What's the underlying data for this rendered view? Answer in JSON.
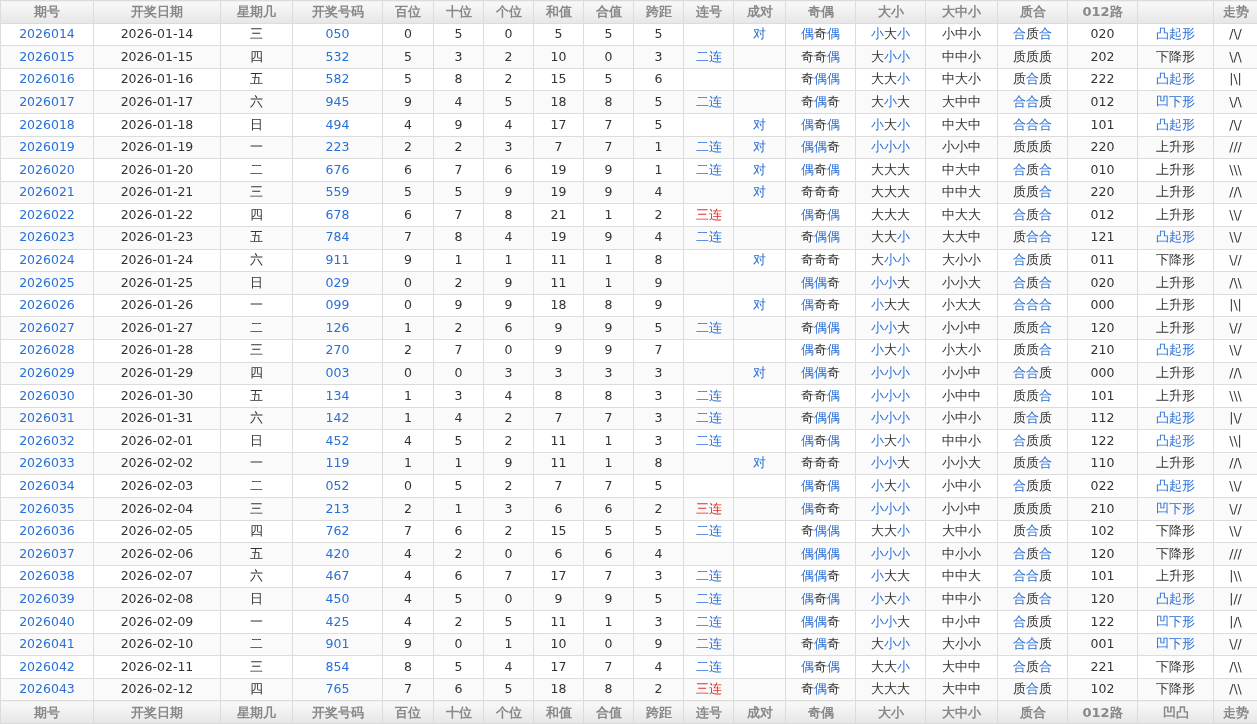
{
  "header": [
    {
      "label": "期号"
    },
    {
      "label": "开奖日期"
    },
    {
      "label": "星期几"
    },
    {
      "label": "开奖号码"
    },
    {
      "label": "百位"
    },
    {
      "label": "十位"
    },
    {
      "label": "个位"
    },
    {
      "label": "和值"
    },
    {
      "label": "合值"
    },
    {
      "label": "跨距"
    },
    {
      "label": "连号"
    },
    {
      "label": "成对"
    },
    {
      "label": "奇偶"
    },
    {
      "label": "大小"
    },
    {
      "label": "大中小"
    },
    {
      "label": "质合"
    },
    {
      "label": "012路"
    },
    {
      "label": "走势"
    }
  ],
  "rows": [
    {
      "c": [
        "2026014",
        "2026-01-14",
        "三",
        "050",
        "0",
        "5",
        "0",
        "5",
        "5",
        "5"
      ],
      "pair": "对",
      "parity": {
        "text": "偶奇偶",
        "hl": [
          true,
          false,
          true
        ]
      },
      "size": {
        "text": "小大小",
        "hl": [
          true,
          false,
          true
        ]
      },
      "range": "小中小",
      "prime": {
        "text": "合质合",
        "hl": [
          true,
          false,
          true
        ]
      },
      "route": "020",
      "shape": {
        "text": "凸起形",
        "hl": true
      },
      "trend": "/\\/"
    },
    {
      "c": [
        "2026015",
        "2026-01-15",
        "四",
        "532",
        "5",
        "3",
        "2",
        "10",
        "0",
        "3"
      ],
      "consec": {
        "text": "二连",
        "kind": "two"
      },
      "parity": {
        "text": "奇奇偶",
        "hl": [
          false,
          false,
          true
        ]
      },
      "size": {
        "text": "大小小",
        "hl": [
          false,
          true,
          true
        ]
      },
      "range": "中中小",
      "prime": {
        "text": "质质质",
        "hl": [
          false,
          false,
          false
        ]
      },
      "route": "202",
      "shape": {
        "text": "下降形",
        "hl": false
      },
      "trend": "\\/\\"
    },
    {
      "c": [
        "2026016",
        "2026-01-16",
        "五",
        "582",
        "5",
        "8",
        "2",
        "15",
        "5",
        "6"
      ],
      "parity": {
        "text": "奇偶偶",
        "hl": [
          false,
          true,
          true
        ]
      },
      "size": {
        "text": "大大小",
        "hl": [
          false,
          false,
          true
        ]
      },
      "range": "中大小",
      "prime": {
        "text": "质合质",
        "hl": [
          false,
          true,
          false
        ]
      },
      "route": "222",
      "shape": {
        "text": "凸起形",
        "hl": true
      },
      "trend": "|\\|"
    },
    {
      "c": [
        "2026017",
        "2026-01-17",
        "六",
        "945",
        "9",
        "4",
        "5",
        "18",
        "8",
        "5"
      ],
      "consec": {
        "text": "二连",
        "kind": "two"
      },
      "parity": {
        "text": "奇偶奇",
        "hl": [
          false,
          true,
          false
        ]
      },
      "size": {
        "text": "大小大",
        "hl": [
          false,
          true,
          false
        ]
      },
      "range": "大中中",
      "prime": {
        "text": "合合质",
        "hl": [
          true,
          true,
          false
        ]
      },
      "route": "012",
      "shape": {
        "text": "凹下形",
        "hl": true
      },
      "trend": "\\/\\"
    },
    {
      "c": [
        "2026018",
        "2026-01-18",
        "日",
        "494",
        "4",
        "9",
        "4",
        "17",
        "7",
        "5"
      ],
      "pair": "对",
      "parity": {
        "text": "偶奇偶",
        "hl": [
          true,
          false,
          true
        ]
      },
      "size": {
        "text": "小大小",
        "hl": [
          true,
          false,
          true
        ]
      },
      "range": "中大中",
      "prime": {
        "text": "合合合",
        "hl": [
          true,
          true,
          true
        ]
      },
      "route": "101",
      "shape": {
        "text": "凸起形",
        "hl": true
      },
      "trend": "/\\/"
    },
    {
      "c": [
        "2026019",
        "2026-01-19",
        "一",
        "223",
        "2",
        "2",
        "3",
        "7",
        "7",
        "1"
      ],
      "consec": {
        "text": "二连",
        "kind": "two"
      },
      "pair": "对",
      "parity": {
        "text": "偶偶奇",
        "hl": [
          true,
          true,
          false
        ]
      },
      "size": {
        "text": "小小小",
        "hl": [
          true,
          true,
          true
        ]
      },
      "range": "小小中",
      "prime": {
        "text": "质质质",
        "hl": [
          false,
          false,
          false
        ]
      },
      "route": "220",
      "shape": {
        "text": "上升形",
        "hl": false
      },
      "trend": "///"
    },
    {
      "c": [
        "2026020",
        "2026-01-20",
        "二",
        "676",
        "6",
        "7",
        "6",
        "19",
        "9",
        "1"
      ],
      "consec": {
        "text": "二连",
        "kind": "two"
      },
      "pair": "对",
      "parity": {
        "text": "偶奇偶",
        "hl": [
          true,
          false,
          true
        ]
      },
      "size": {
        "text": "大大大",
        "hl": [
          false,
          false,
          false
        ]
      },
      "range": "中大中",
      "prime": {
        "text": "合质合",
        "hl": [
          true,
          false,
          true
        ]
      },
      "route": "010",
      "shape": {
        "text": "上升形",
        "hl": false
      },
      "trend": "\\\\\\"
    },
    {
      "c": [
        "2026021",
        "2026-01-21",
        "三",
        "559",
        "5",
        "5",
        "9",
        "19",
        "9",
        "4"
      ],
      "pair": "对",
      "parity": {
        "text": "奇奇奇",
        "hl": [
          false,
          false,
          false
        ]
      },
      "size": {
        "text": "大大大",
        "hl": [
          false,
          false,
          false
        ]
      },
      "range": "中中大",
      "prime": {
        "text": "质质合",
        "hl": [
          false,
          false,
          true
        ]
      },
      "route": "220",
      "shape": {
        "text": "上升形",
        "hl": false
      },
      "trend": "//\\"
    },
    {
      "c": [
        "2026022",
        "2026-01-22",
        "四",
        "678",
        "6",
        "7",
        "8",
        "21",
        "1",
        "2"
      ],
      "consec": {
        "text": "三连",
        "kind": "three"
      },
      "parity": {
        "text": "偶奇偶",
        "hl": [
          true,
          false,
          true
        ]
      },
      "size": {
        "text": "大大大",
        "hl": [
          false,
          false,
          false
        ]
      },
      "range": "中大大",
      "prime": {
        "text": "合质合",
        "hl": [
          true,
          false,
          true
        ]
      },
      "route": "012",
      "shape": {
        "text": "上升形",
        "hl": false
      },
      "trend": "\\\\/"
    },
    {
      "c": [
        "2026023",
        "2026-01-23",
        "五",
        "784",
        "7",
        "8",
        "4",
        "19",
        "9",
        "4"
      ],
      "consec": {
        "text": "二连",
        "kind": "two"
      },
      "parity": {
        "text": "奇偶偶",
        "hl": [
          false,
          true,
          true
        ]
      },
      "size": {
        "text": "大大小",
        "hl": [
          false,
          false,
          true
        ]
      },
      "range": "大大中",
      "prime": {
        "text": "质合合",
        "hl": [
          false,
          true,
          true
        ]
      },
      "route": "121",
      "shape": {
        "text": "凸起形",
        "hl": true
      },
      "trend": "\\\\/"
    },
    {
      "c": [
        "2026024",
        "2026-01-24",
        "六",
        "911",
        "9",
        "1",
        "1",
        "11",
        "1",
        "8"
      ],
      "pair": "对",
      "parity": {
        "text": "奇奇奇",
        "hl": [
          false,
          false,
          false
        ]
      },
      "size": {
        "text": "大小小",
        "hl": [
          false,
          true,
          true
        ]
      },
      "range": "大小小",
      "prime": {
        "text": "合质质",
        "hl": [
          true,
          false,
          false
        ]
      },
      "route": "011",
      "shape": {
        "text": "下降形",
        "hl": false
      },
      "trend": "\\//"
    },
    {
      "c": [
        "2026025",
        "2026-01-25",
        "日",
        "029",
        "0",
        "2",
        "9",
        "11",
        "1",
        "9"
      ],
      "parity": {
        "text": "偶偶奇",
        "hl": [
          true,
          true,
          false
        ]
      },
      "size": {
        "text": "小小大",
        "hl": [
          true,
          true,
          false
        ]
      },
      "range": "小小大",
      "prime": {
        "text": "合质合",
        "hl": [
          true,
          false,
          true
        ]
      },
      "route": "020",
      "shape": {
        "text": "上升形",
        "hl": false
      },
      "trend": "/\\\\"
    },
    {
      "c": [
        "2026026",
        "2026-01-26",
        "一",
        "099",
        "0",
        "9",
        "9",
        "18",
        "8",
        "9"
      ],
      "pair": "对",
      "parity": {
        "text": "偶奇奇",
        "hl": [
          true,
          false,
          false
        ]
      },
      "size": {
        "text": "小大大",
        "hl": [
          true,
          false,
          false
        ]
      },
      "range": "小大大",
      "prime": {
        "text": "合合合",
        "hl": [
          true,
          true,
          true
        ]
      },
      "route": "000",
      "shape": {
        "text": "上升形",
        "hl": false
      },
      "trend": "|\\|"
    },
    {
      "c": [
        "2026027",
        "2026-01-27",
        "二",
        "126",
        "1",
        "2",
        "6",
        "9",
        "9",
        "5"
      ],
      "consec": {
        "text": "二连",
        "kind": "two"
      },
      "parity": {
        "text": "奇偶偶",
        "hl": [
          false,
          true,
          true
        ]
      },
      "size": {
        "text": "小小大",
        "hl": [
          true,
          true,
          false
        ]
      },
      "range": "小小中",
      "prime": {
        "text": "质质合",
        "hl": [
          false,
          false,
          true
        ]
      },
      "route": "120",
      "shape": {
        "text": "上升形",
        "hl": false
      },
      "trend": "\\//"
    },
    {
      "c": [
        "2026028",
        "2026-01-28",
        "三",
        "270",
        "2",
        "7",
        "0",
        "9",
        "9",
        "7"
      ],
      "parity": {
        "text": "偶奇偶",
        "hl": [
          true,
          false,
          true
        ]
      },
      "size": {
        "text": "小大小",
        "hl": [
          true,
          false,
          true
        ]
      },
      "range": "小大小",
      "prime": {
        "text": "质质合",
        "hl": [
          false,
          false,
          true
        ]
      },
      "route": "210",
      "shape": {
        "text": "凸起形",
        "hl": true
      },
      "trend": "\\\\/"
    },
    {
      "c": [
        "2026029",
        "2026-01-29",
        "四",
        "003",
        "0",
        "0",
        "3",
        "3",
        "3",
        "3"
      ],
      "pair": "对",
      "parity": {
        "text": "偶偶奇",
        "hl": [
          true,
          true,
          false
        ]
      },
      "size": {
        "text": "小小小",
        "hl": [
          true,
          true,
          true
        ]
      },
      "range": "小小中",
      "prime": {
        "text": "合合质",
        "hl": [
          true,
          true,
          false
        ]
      },
      "route": "000",
      "shape": {
        "text": "上升形",
        "hl": false
      },
      "trend": "//\\"
    },
    {
      "c": [
        "2026030",
        "2026-01-30",
        "五",
        "134",
        "1",
        "3",
        "4",
        "8",
        "8",
        "3"
      ],
      "consec": {
        "text": "二连",
        "kind": "two"
      },
      "parity": {
        "text": "奇奇偶",
        "hl": [
          false,
          false,
          true
        ]
      },
      "size": {
        "text": "小小小",
        "hl": [
          true,
          true,
          true
        ]
      },
      "range": "小中中",
      "prime": {
        "text": "质质合",
        "hl": [
          false,
          false,
          true
        ]
      },
      "route": "101",
      "shape": {
        "text": "上升形",
        "hl": false
      },
      "trend": "\\\\\\"
    },
    {
      "c": [
        "2026031",
        "2026-01-31",
        "六",
        "142",
        "1",
        "4",
        "2",
        "7",
        "7",
        "3"
      ],
      "consec": {
        "text": "二连",
        "kind": "two"
      },
      "parity": {
        "text": "奇偶偶",
        "hl": [
          false,
          true,
          true
        ]
      },
      "size": {
        "text": "小小小",
        "hl": [
          true,
          true,
          true
        ]
      },
      "range": "小中小",
      "prime": {
        "text": "质合质",
        "hl": [
          false,
          true,
          false
        ]
      },
      "route": "112",
      "shape": {
        "text": "凸起形",
        "hl": true
      },
      "trend": "|\\/"
    },
    {
      "c": [
        "2026032",
        "2026-02-01",
        "日",
        "452",
        "4",
        "5",
        "2",
        "11",
        "1",
        "3"
      ],
      "consec": {
        "text": "二连",
        "kind": "two"
      },
      "parity": {
        "text": "偶奇偶",
        "hl": [
          true,
          false,
          true
        ]
      },
      "size": {
        "text": "小大小",
        "hl": [
          true,
          false,
          true
        ]
      },
      "range": "中中小",
      "prime": {
        "text": "合质质",
        "hl": [
          true,
          false,
          false
        ]
      },
      "route": "122",
      "shape": {
        "text": "凸起形",
        "hl": true
      },
      "trend": "\\\\|"
    },
    {
      "c": [
        "2026033",
        "2026-02-02",
        "一",
        "119",
        "1",
        "1",
        "9",
        "11",
        "1",
        "8"
      ],
      "pair": "对",
      "parity": {
        "text": "奇奇奇",
        "hl": [
          false,
          false,
          false
        ]
      },
      "size": {
        "text": "小小大",
        "hl": [
          true,
          true,
          false
        ]
      },
      "range": "小小大",
      "prime": {
        "text": "质质合",
        "hl": [
          false,
          false,
          true
        ]
      },
      "route": "110",
      "shape": {
        "text": "上升形",
        "hl": false
      },
      "trend": "//\\"
    },
    {
      "c": [
        "2026034",
        "2026-02-03",
        "二",
        "052",
        "0",
        "5",
        "2",
        "7",
        "7",
        "5"
      ],
      "parity": {
        "text": "偶奇偶",
        "hl": [
          true,
          false,
          true
        ]
      },
      "size": {
        "text": "小大小",
        "hl": [
          true,
          false,
          true
        ]
      },
      "range": "小中小",
      "prime": {
        "text": "合质质",
        "hl": [
          true,
          false,
          false
        ]
      },
      "route": "022",
      "shape": {
        "text": "凸起形",
        "hl": true
      },
      "trend": "\\\\/"
    },
    {
      "c": [
        "2026035",
        "2026-02-04",
        "三",
        "213",
        "2",
        "1",
        "3",
        "6",
        "6",
        "2"
      ],
      "consec": {
        "text": "三连",
        "kind": "three"
      },
      "parity": {
        "text": "偶奇奇",
        "hl": [
          true,
          false,
          false
        ]
      },
      "size": {
        "text": "小小小",
        "hl": [
          true,
          true,
          true
        ]
      },
      "range": "小小中",
      "prime": {
        "text": "质质质",
        "hl": [
          false,
          false,
          false
        ]
      },
      "route": "210",
      "shape": {
        "text": "凹下形",
        "hl": true
      },
      "trend": "\\//"
    },
    {
      "c": [
        "2026036",
        "2026-02-05",
        "四",
        "762",
        "7",
        "6",
        "2",
        "15",
        "5",
        "5"
      ],
      "consec": {
        "text": "二连",
        "kind": "two"
      },
      "parity": {
        "text": "奇偶偶",
        "hl": [
          false,
          true,
          true
        ]
      },
      "size": {
        "text": "大大小",
        "hl": [
          false,
          false,
          true
        ]
      },
      "range": "大中小",
      "prime": {
        "text": "质合质",
        "hl": [
          false,
          true,
          false
        ]
      },
      "route": "102",
      "shape": {
        "text": "下降形",
        "hl": false
      },
      "trend": "\\\\/"
    },
    {
      "c": [
        "2026037",
        "2026-02-06",
        "五",
        "420",
        "4",
        "2",
        "0",
        "6",
        "6",
        "4"
      ],
      "parity": {
        "text": "偶偶偶",
        "hl": [
          true,
          true,
          true
        ]
      },
      "size": {
        "text": "小小小",
        "hl": [
          true,
          true,
          true
        ]
      },
      "range": "中小小",
      "prime": {
        "text": "合质合",
        "hl": [
          true,
          false,
          true
        ]
      },
      "route": "120",
      "shape": {
        "text": "下降形",
        "hl": false
      },
      "trend": "///"
    },
    {
      "c": [
        "2026038",
        "2026-02-07",
        "六",
        "467",
        "4",
        "6",
        "7",
        "17",
        "7",
        "3"
      ],
      "consec": {
        "text": "二连",
        "kind": "two"
      },
      "parity": {
        "text": "偶偶奇",
        "hl": [
          true,
          true,
          false
        ]
      },
      "size": {
        "text": "小大大",
        "hl": [
          true,
          false,
          false
        ]
      },
      "range": "中中大",
      "prime": {
        "text": "合合质",
        "hl": [
          true,
          true,
          false
        ]
      },
      "route": "101",
      "shape": {
        "text": "上升形",
        "hl": false
      },
      "trend": "|\\\\"
    },
    {
      "c": [
        "2026039",
        "2026-02-08",
        "日",
        "450",
        "4",
        "5",
        "0",
        "9",
        "9",
        "5"
      ],
      "consec": {
        "text": "二连",
        "kind": "two"
      },
      "parity": {
        "text": "偶奇偶",
        "hl": [
          true,
          false,
          true
        ]
      },
      "size": {
        "text": "小大小",
        "hl": [
          true,
          false,
          true
        ]
      },
      "range": "中中小",
      "prime": {
        "text": "合质合",
        "hl": [
          true,
          false,
          true
        ]
      },
      "route": "120",
      "shape": {
        "text": "凸起形",
        "hl": true
      },
      "trend": "|//"
    },
    {
      "c": [
        "2026040",
        "2026-02-09",
        "一",
        "425",
        "4",
        "2",
        "5",
        "11",
        "1",
        "3"
      ],
      "consec": {
        "text": "二连",
        "kind": "two"
      },
      "parity": {
        "text": "偶偶奇",
        "hl": [
          true,
          true,
          false
        ]
      },
      "size": {
        "text": "小小大",
        "hl": [
          true,
          true,
          false
        ]
      },
      "range": "中小中",
      "prime": {
        "text": "合质质",
        "hl": [
          true,
          false,
          false
        ]
      },
      "route": "122",
      "shape": {
        "text": "凹下形",
        "hl": true
      },
      "trend": "|/\\"
    },
    {
      "c": [
        "2026041",
        "2026-02-10",
        "二",
        "901",
        "9",
        "0",
        "1",
        "10",
        "0",
        "9"
      ],
      "consec": {
        "text": "二连",
        "kind": "two"
      },
      "parity": {
        "text": "奇偶奇",
        "hl": [
          false,
          true,
          false
        ]
      },
      "size": {
        "text": "大小小",
        "hl": [
          false,
          true,
          true
        ]
      },
      "range": "大小小",
      "prime": {
        "text": "合合质",
        "hl": [
          true,
          true,
          false
        ]
      },
      "route": "001",
      "shape": {
        "text": "凹下形",
        "hl": true
      },
      "trend": "\\//"
    },
    {
      "c": [
        "2026042",
        "2026-02-11",
        "三",
        "854",
        "8",
        "5",
        "4",
        "17",
        "7",
        "4"
      ],
      "consec": {
        "text": "二连",
        "kind": "two"
      },
      "parity": {
        "text": "偶奇偶",
        "hl": [
          true,
          false,
          true
        ]
      },
      "size": {
        "text": "大大小",
        "hl": [
          false,
          false,
          true
        ]
      },
      "range": "大中中",
      "prime": {
        "text": "合质合",
        "hl": [
          true,
          false,
          true
        ]
      },
      "route": "221",
      "shape": {
        "text": "下降形",
        "hl": false
      },
      "trend": "/\\\\"
    },
    {
      "c": [
        "2026043",
        "2026-02-12",
        "四",
        "765",
        "7",
        "6",
        "5",
        "18",
        "8",
        "2"
      ],
      "consec": {
        "text": "三连",
        "kind": "three"
      },
      "parity": {
        "text": "奇偶奇",
        "hl": [
          false,
          true,
          false
        ]
      },
      "size": {
        "text": "大大大",
        "hl": [
          false,
          false,
          false
        ]
      },
      "range": "大中中",
      "prime": {
        "text": "质合质",
        "hl": [
          false,
          true,
          false
        ]
      },
      "route": "102",
      "shape": {
        "text": "下降形",
        "hl": false
      },
      "trend": "/\\\\"
    }
  ],
  "footer": [
    "期号",
    "开奖日期",
    "星期几",
    "开奖号码",
    "百位",
    "十位",
    "个位",
    "和值",
    "合值",
    "跨距",
    "连号",
    "成对",
    "奇偶",
    "大小",
    "大中小",
    "质合",
    "012路",
    "凹凸",
    "走势"
  ]
}
